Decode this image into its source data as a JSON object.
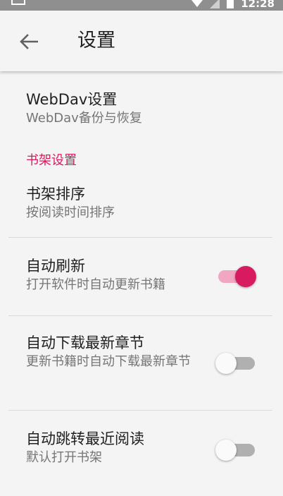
{
  "status_bar": {
    "time": "12:28"
  },
  "app_bar": {
    "title": "设置",
    "back_icon": "arrow-left-icon"
  },
  "preferences": {
    "webdav": {
      "title": "WebDav设置",
      "summary": "WebDav备份与恢复"
    },
    "bookshelf_category": "书架设置",
    "sort": {
      "title": "书架排序",
      "summary": "按阅读时间排序"
    },
    "auto_refresh": {
      "title": "自动刷新",
      "summary": "打开软件时自动更新书籍",
      "enabled": true
    },
    "auto_download": {
      "title": "自动下载最新章节",
      "summary": "更新书籍时自动下载最新章节",
      "enabled": false
    },
    "auto_jump": {
      "title": "自动跳转最近阅读",
      "summary": "默认打开书架",
      "enabled": false
    }
  },
  "colors": {
    "accent": "#d81b60",
    "accent_track": "#f1a7c2",
    "background": "#f4f4f4"
  }
}
